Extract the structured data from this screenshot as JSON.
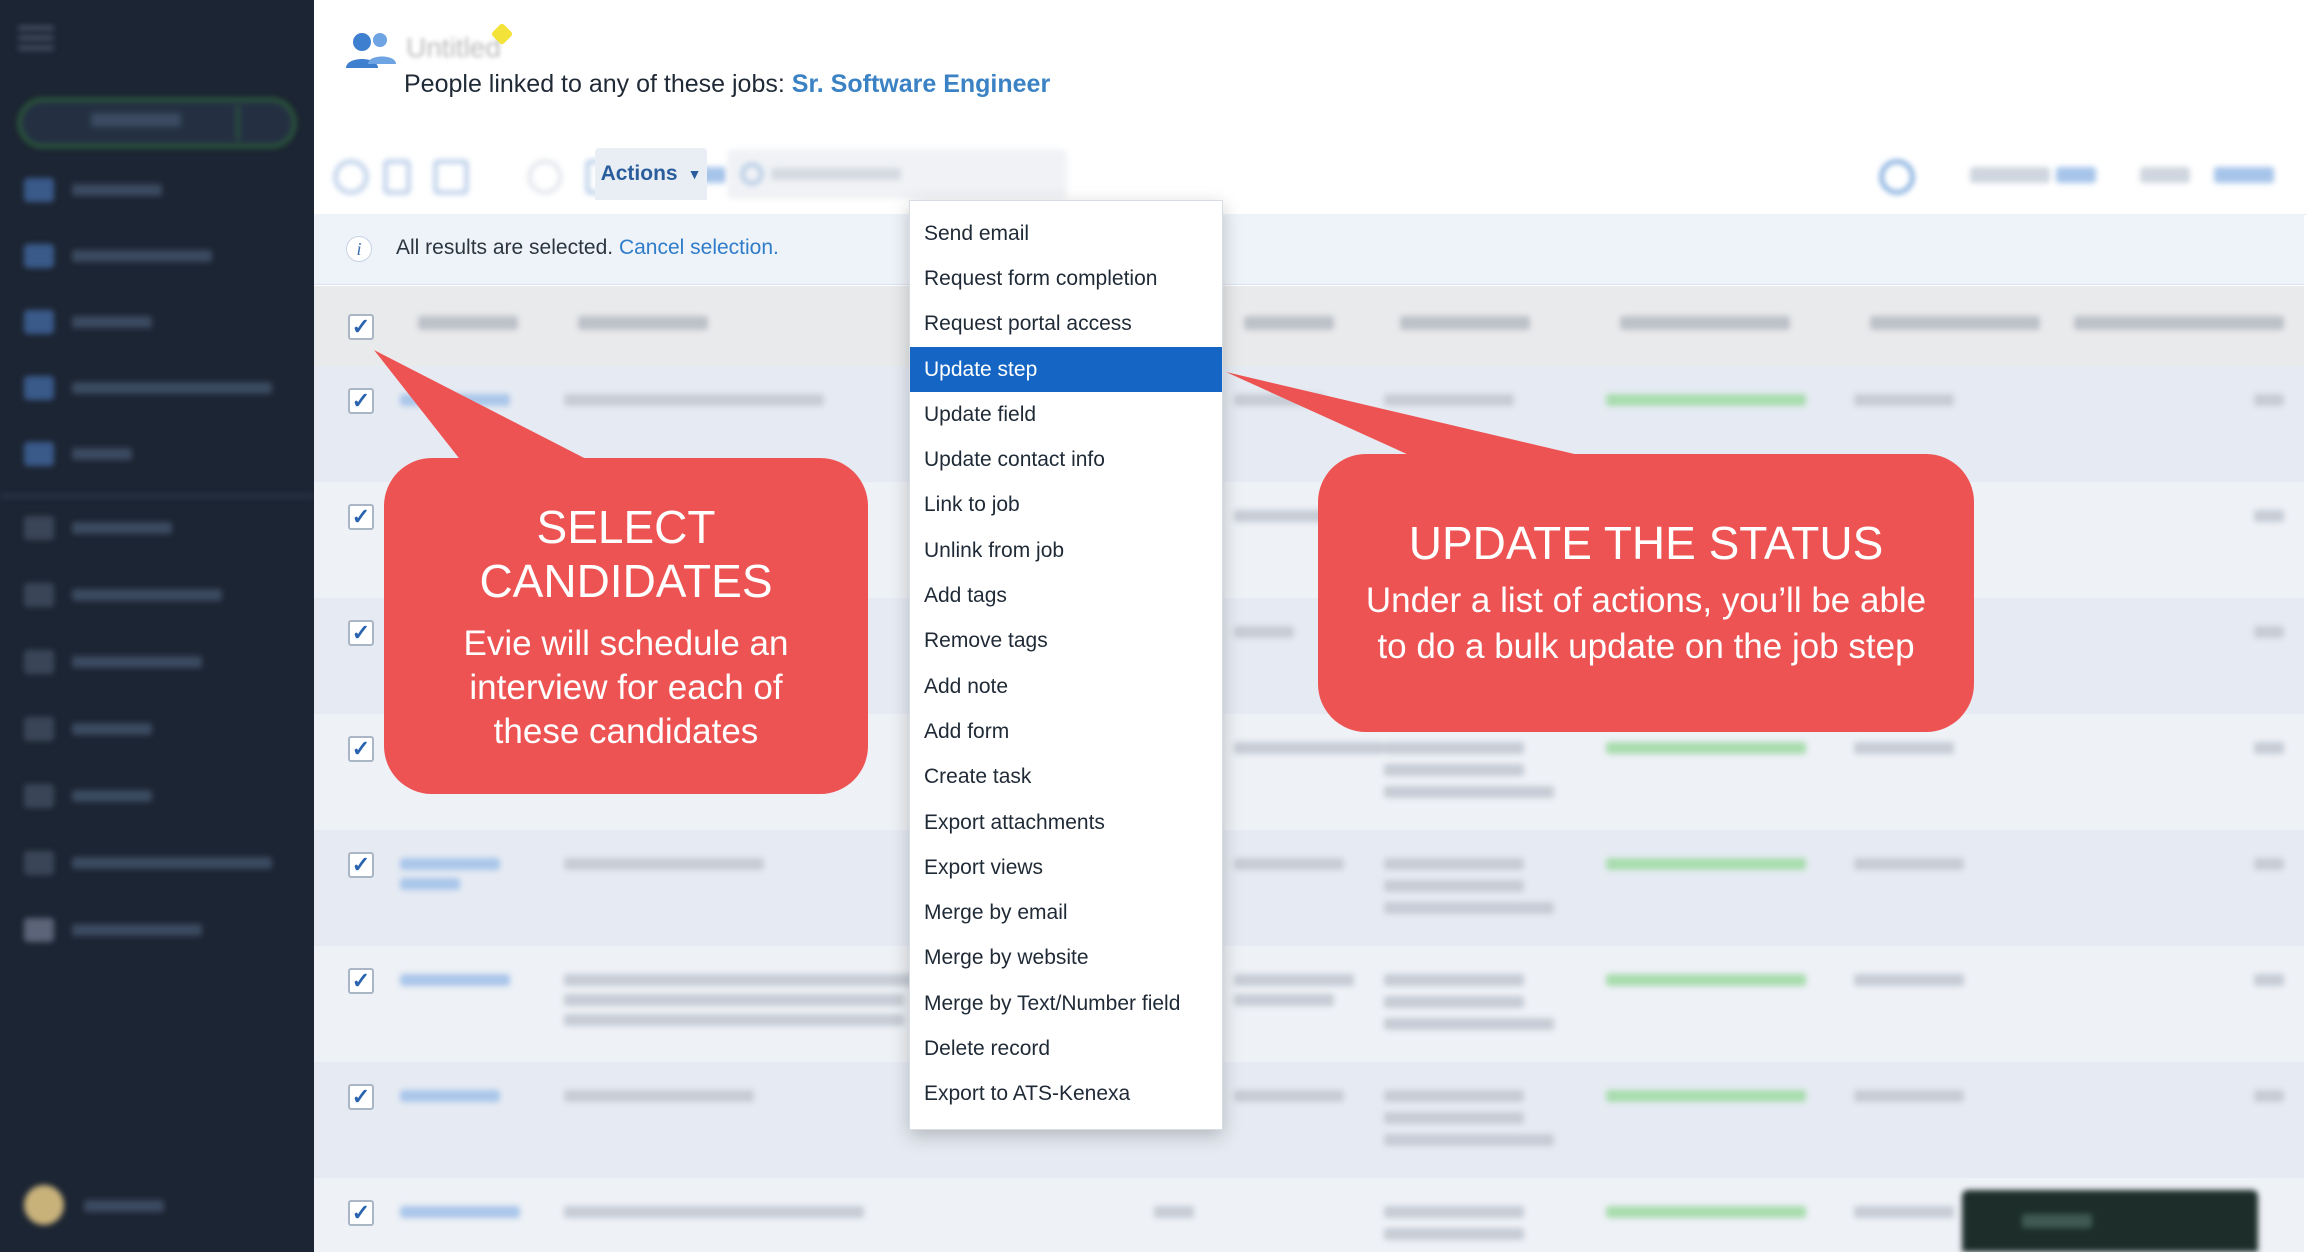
{
  "header": {
    "subtitle_prefix": "People linked to any of these jobs:",
    "job_link": "Sr. Software Engineer"
  },
  "toolbar": {
    "actions_label": "Actions"
  },
  "banner": {
    "text": "All results are selected.",
    "cancel_link": "Cancel selection."
  },
  "actions_menu": {
    "items": [
      "Send email",
      "Request form completion",
      "Request portal access",
      "Update step",
      "Update field",
      "Update contact info",
      "Link to job",
      "Unlink from job",
      "Add tags",
      "Remove tags",
      "Add note",
      "Add form",
      "Create task",
      "Export attachments",
      "Export views",
      "Merge by email",
      "Merge by website",
      "Merge by Text/Number field",
      "Delete record",
      "Export to ATS-Kenexa"
    ],
    "active_item": "Update step"
  },
  "callouts": {
    "left": {
      "title_line1": "SELECT",
      "title_line2": "CANDIDATES",
      "body_line1": "Evie will schedule an",
      "body_line2": "interview for each of",
      "body_line3": "these candidates"
    },
    "right": {
      "title": "UPDATE THE STATUS",
      "body_line1": "Under a list of actions, you’ll be able",
      "body_line2": "to do a bulk update on the job step"
    }
  },
  "checkbox": {
    "check_glyph": "✓"
  },
  "colors": {
    "sidebar_bg": "#1c2533",
    "accent_blue": "#1566c4",
    "link_blue": "#3b82c4",
    "callout_red": "#ee5353"
  },
  "icons": [
    "menu-icon",
    "people-icon",
    "info-icon",
    "chevron-down-icon",
    "search-icon",
    "checkbox-icon"
  ]
}
